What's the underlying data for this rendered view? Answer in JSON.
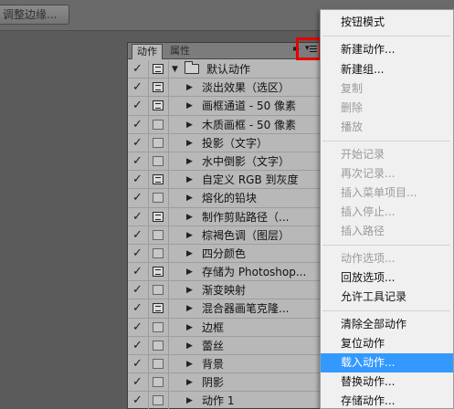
{
  "toolbar": {
    "refine_edge_label": "调整边缘..."
  },
  "panel": {
    "tabs": [
      {
        "label": "动作"
      },
      {
        "label": "属性"
      }
    ],
    "expand_glyph": "▸▸",
    "menu_glyph": "▾",
    "set": {
      "name": "默认动作",
      "checked": true,
      "dialog": true,
      "expanded": true
    },
    "actions": [
      {
        "name": "淡出效果（选区）",
        "checked": true,
        "dialog": true
      },
      {
        "name": "画框通道 - 50 像素",
        "checked": true,
        "dialog": true
      },
      {
        "name": "木质画框 - 50 像素",
        "checked": true,
        "dialog": false
      },
      {
        "name": "投影（文字）",
        "checked": true,
        "dialog": false
      },
      {
        "name": "水中倒影（文字）",
        "checked": true,
        "dialog": false
      },
      {
        "name": "自定义 RGB 到灰度",
        "checked": true,
        "dialog": true
      },
      {
        "name": "熔化的铅块",
        "checked": true,
        "dialog": false
      },
      {
        "name": "制作剪贴路径（...",
        "checked": true,
        "dialog": true
      },
      {
        "name": "棕褐色调（图层）",
        "checked": true,
        "dialog": false
      },
      {
        "name": "四分颜色",
        "checked": true,
        "dialog": false
      },
      {
        "name": "存储为 Photoshop...",
        "checked": true,
        "dialog": true
      },
      {
        "name": "渐变映射",
        "checked": true,
        "dialog": false
      },
      {
        "name": "混合器画笔克隆...",
        "checked": true,
        "dialog": true
      },
      {
        "name": "边框",
        "checked": true,
        "dialog": false
      },
      {
        "name": "蕾丝",
        "checked": true,
        "dialog": false
      },
      {
        "name": "背景",
        "checked": true,
        "dialog": false
      },
      {
        "name": "阴影",
        "checked": true,
        "dialog": false
      },
      {
        "name": "动作 1",
        "checked": true,
        "dialog": false
      }
    ],
    "check_glyph": "✓",
    "collapsed_glyph": "▶",
    "expanded_glyph": "▼"
  },
  "menu": {
    "items": [
      {
        "label": "按钮模式",
        "enabled": true
      },
      {
        "label": "新建动作...",
        "enabled": true
      },
      {
        "label": "新建组...",
        "enabled": true
      },
      {
        "label": "复制",
        "enabled": false
      },
      {
        "label": "删除",
        "enabled": false
      },
      {
        "label": "播放",
        "enabled": false
      },
      {
        "label": "开始记录",
        "enabled": false
      },
      {
        "label": "再次记录...",
        "enabled": false
      },
      {
        "label": "插入菜单项目...",
        "enabled": false
      },
      {
        "label": "插入停止...",
        "enabled": false
      },
      {
        "label": "插入路径",
        "enabled": false
      },
      {
        "label": "动作选项...",
        "enabled": false
      },
      {
        "label": "回放选项...",
        "enabled": true
      },
      {
        "label": "允许工具记录",
        "enabled": true
      },
      {
        "label": "清除全部动作",
        "enabled": true
      },
      {
        "label": "复位动作",
        "enabled": true
      },
      {
        "label": "载入动作...",
        "enabled": true,
        "highlighted": true
      },
      {
        "label": "替换动作...",
        "enabled": true
      },
      {
        "label": "存储动作...",
        "enabled": true
      }
    ]
  },
  "colors": {
    "workspace": "#5b5b5b",
    "panel_bg": "#b8b8b8",
    "highlight": "#3399ff",
    "menu_button_outline": "#e80000"
  }
}
